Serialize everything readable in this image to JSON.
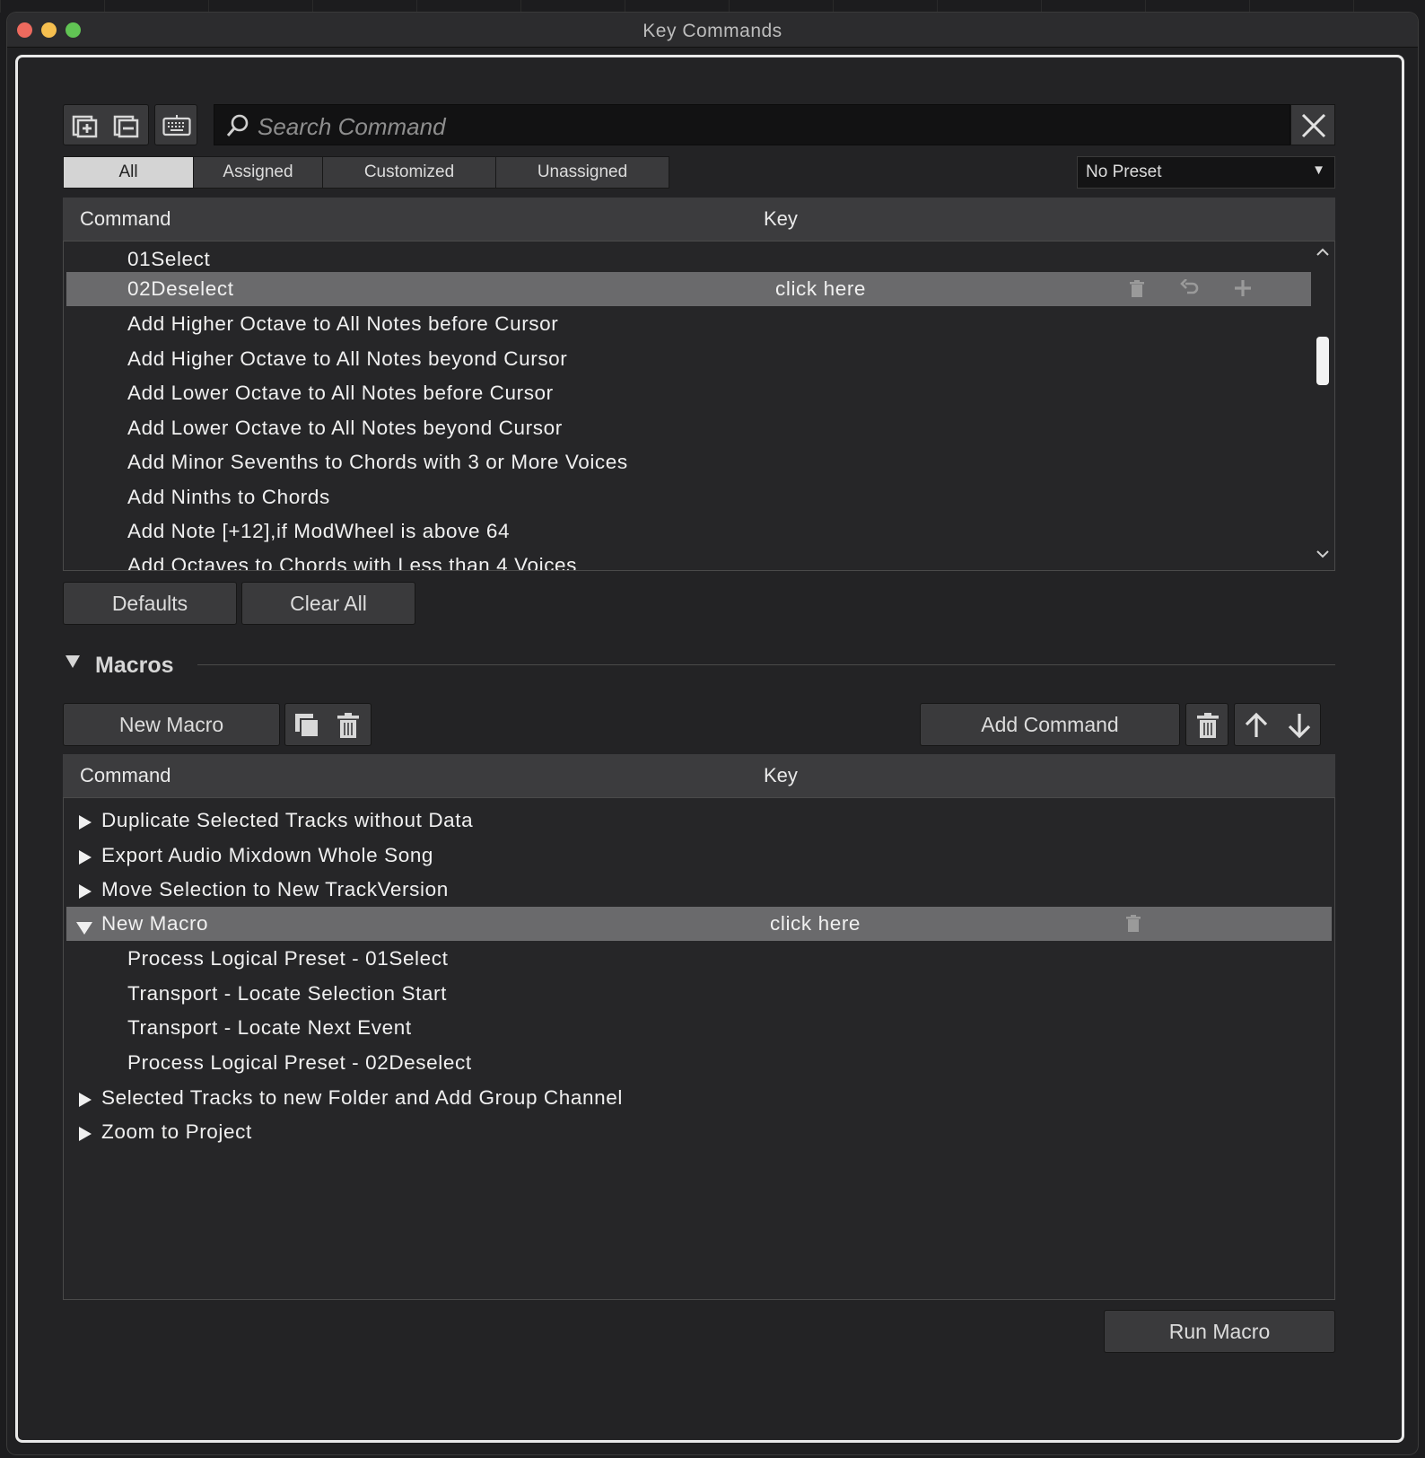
{
  "window": {
    "title": "Key Commands"
  },
  "search": {
    "placeholder": "Search Command"
  },
  "filter_tabs": [
    {
      "label": "All",
      "active": true
    },
    {
      "label": "Assigned",
      "active": false
    },
    {
      "label": "Customized",
      "active": false
    },
    {
      "label": "Unassigned",
      "active": false
    }
  ],
  "preset": {
    "selected": "No Preset"
  },
  "commands_table": {
    "col_command": "Command",
    "col_key": "Key",
    "rows": [
      {
        "command": "01Select",
        "key": ""
      },
      {
        "command": "02Deselect",
        "key": "click here",
        "selected": true
      },
      {
        "command": "Add Higher Octave to All Notes before Cursor",
        "key": ""
      },
      {
        "command": "Add Higher Octave to All Notes beyond Cursor",
        "key": ""
      },
      {
        "command": "Add Lower Octave to All Notes before Cursor",
        "key": ""
      },
      {
        "command": "Add Lower Octave to All Notes beyond Cursor",
        "key": ""
      },
      {
        "command": "Add Minor Sevenths to Chords with 3 or More Voices",
        "key": ""
      },
      {
        "command": "Add Ninths to Chords",
        "key": ""
      },
      {
        "command": "Add Note [+12],if ModWheel is above 64",
        "key": ""
      },
      {
        "command": "Add Octaves to Chords with Less than 4 Voices",
        "key": ""
      }
    ]
  },
  "buttons": {
    "defaults": "Defaults",
    "clear_all": "Clear All",
    "new_macro": "New Macro",
    "add_command": "Add Command",
    "run_macro": "Run Macro"
  },
  "macros": {
    "section_title": "Macros",
    "col_command": "Command",
    "col_key": "Key",
    "rows": [
      {
        "label": "Duplicate Selected Tracks without Data",
        "level": 0,
        "expanded": false
      },
      {
        "label": "Export Audio Mixdown Whole Song",
        "level": 0,
        "expanded": false
      },
      {
        "label": "Move Selection to New TrackVersion",
        "level": 0,
        "expanded": false
      },
      {
        "label": "New Macro",
        "level": 0,
        "expanded": true,
        "selected": true,
        "key": "click here"
      },
      {
        "label": "Process Logical Preset - 01Select",
        "level": 1
      },
      {
        "label": "Transport - Locate Selection Start",
        "level": 1
      },
      {
        "label": "Transport - Locate Next Event",
        "level": 1
      },
      {
        "label": "Process Logical Preset - 02Deselect",
        "level": 1
      },
      {
        "label": "Selected Tracks to new Folder and Add Group Channel",
        "level": 0,
        "expanded": false
      },
      {
        "label": "Zoom to Project",
        "level": 0,
        "expanded": false
      }
    ]
  },
  "icons": {
    "add_folder": "add-folder-icon",
    "remove_folder": "remove-folder-icon",
    "keyboard": "keyboard-icon",
    "search": "search-icon",
    "close": "close-icon",
    "trash": "trash-icon",
    "undo": "undo-icon",
    "plus": "plus-icon",
    "duplicate": "duplicate-icon",
    "arrow_up": "arrow-up-icon",
    "arrow_down": "arrow-down-icon"
  }
}
